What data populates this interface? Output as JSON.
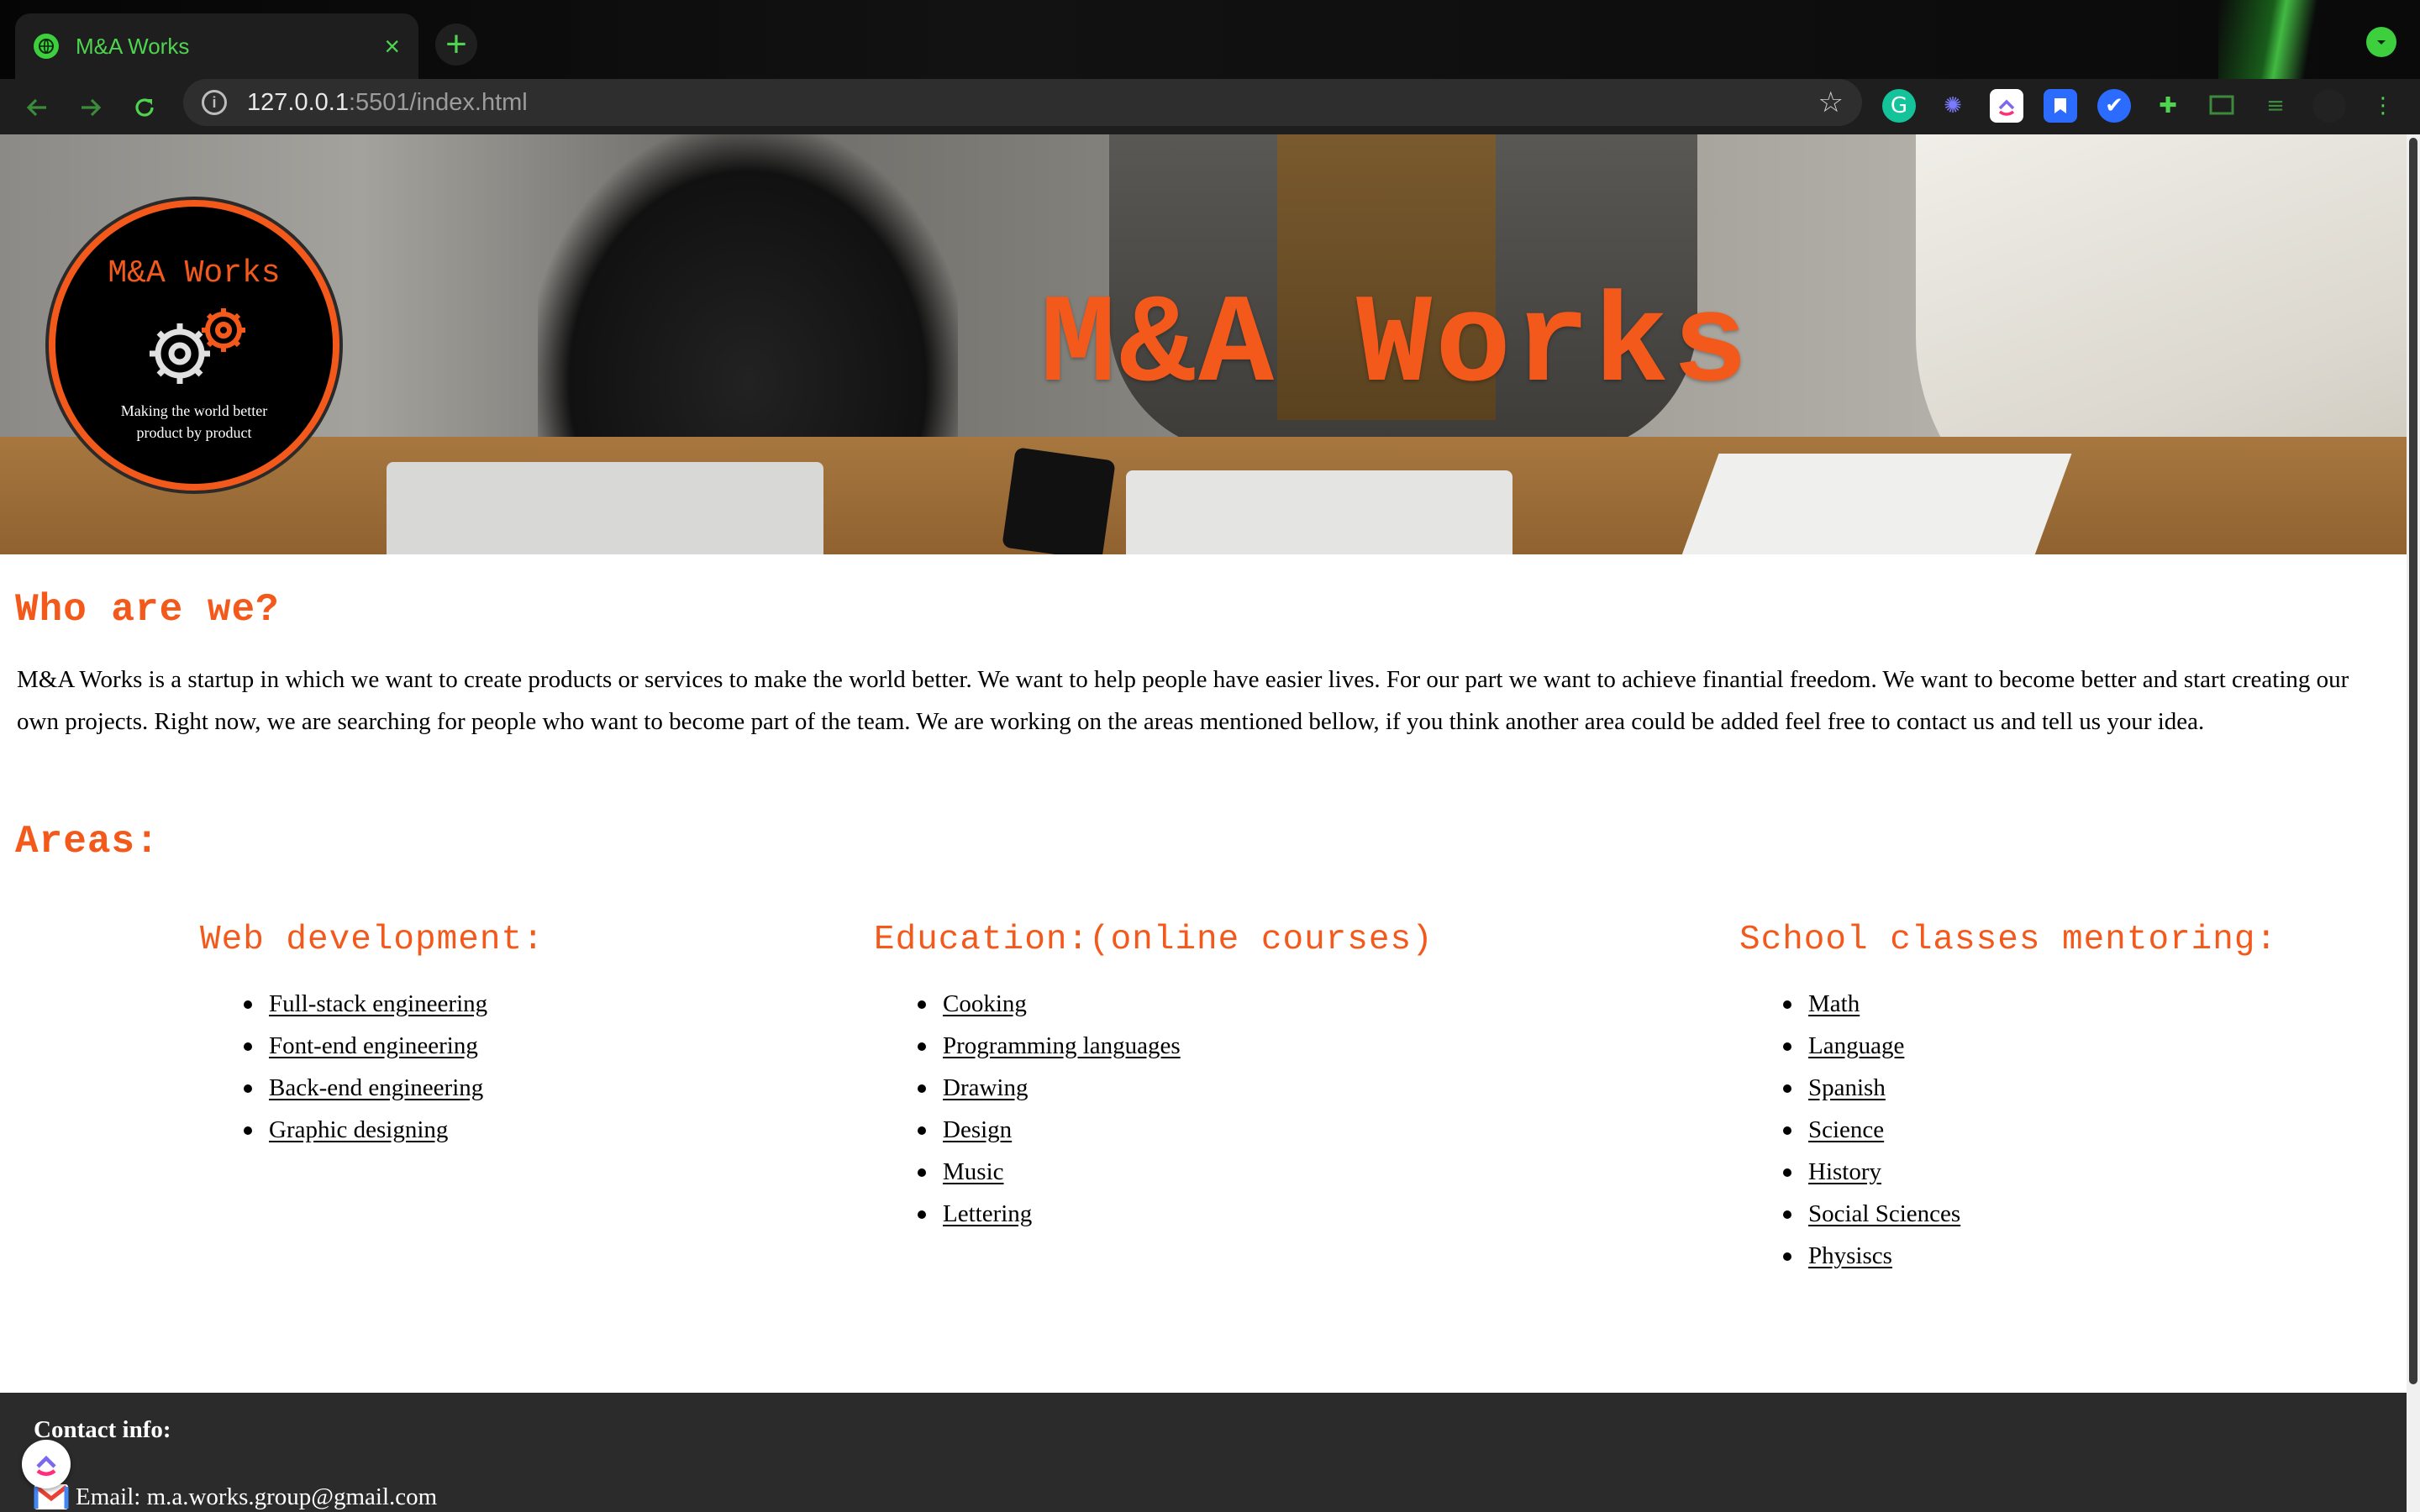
{
  "browser": {
    "tab_title": "M&A Works",
    "tab_close": "×",
    "new_tab": "+",
    "url_host": "127.0.0.1",
    "url_rest": ":5501/index.html",
    "icons": {
      "back": "arrow-left-icon",
      "forward": "arrow-right-icon",
      "reload": "reload-icon",
      "info": "info-icon",
      "bookmark": "star-icon",
      "extensions": [
        "grammarly-icon",
        "sparkle-icon",
        "clickup-icon",
        "bookmark-icon",
        "check-icon",
        "puzzle-icon",
        "cast-icon",
        "playlist-icon",
        "avatar-icon",
        "menu-icon"
      ]
    },
    "accent_color": "#4fd44f"
  },
  "hero": {
    "logo_title": "M&A Works",
    "logo_tagline": "Making the world better product by product",
    "title": "M&A Works",
    "accent_color": "#f4591c"
  },
  "about": {
    "heading": "Who are we?",
    "text": "M&A Works is a startup in which we want to create products or services to make the world better. We want to help people have easier lives. For our part we want to achieve finantial freedom. We want to become better and start creating our own projects. Right now, we are searching for people who want to become part of the team. We are working on the areas mentioned bellow, if you think another area could be added feel free to contact us and tell us your idea."
  },
  "areas": {
    "heading": "Areas:",
    "columns": [
      {
        "title": "Web development:",
        "items": [
          "Full-stack engineering",
          "Font-end engineering",
          "Back-end engineering",
          "Graphic designing"
        ]
      },
      {
        "title": "Education:(online courses)",
        "items": [
          "Cooking",
          "Programming languages",
          "Drawing",
          "Design",
          "Music",
          "Lettering"
        ]
      },
      {
        "title": "School classes mentoring:",
        "items": [
          "Math",
          "Language",
          "Spanish",
          "Science",
          "History",
          "Social Sciences",
          "Physiscs"
        ]
      }
    ]
  },
  "footer": {
    "contact_title": "Contact info:",
    "email": "Email: m.a.works.group@gmail.com"
  }
}
